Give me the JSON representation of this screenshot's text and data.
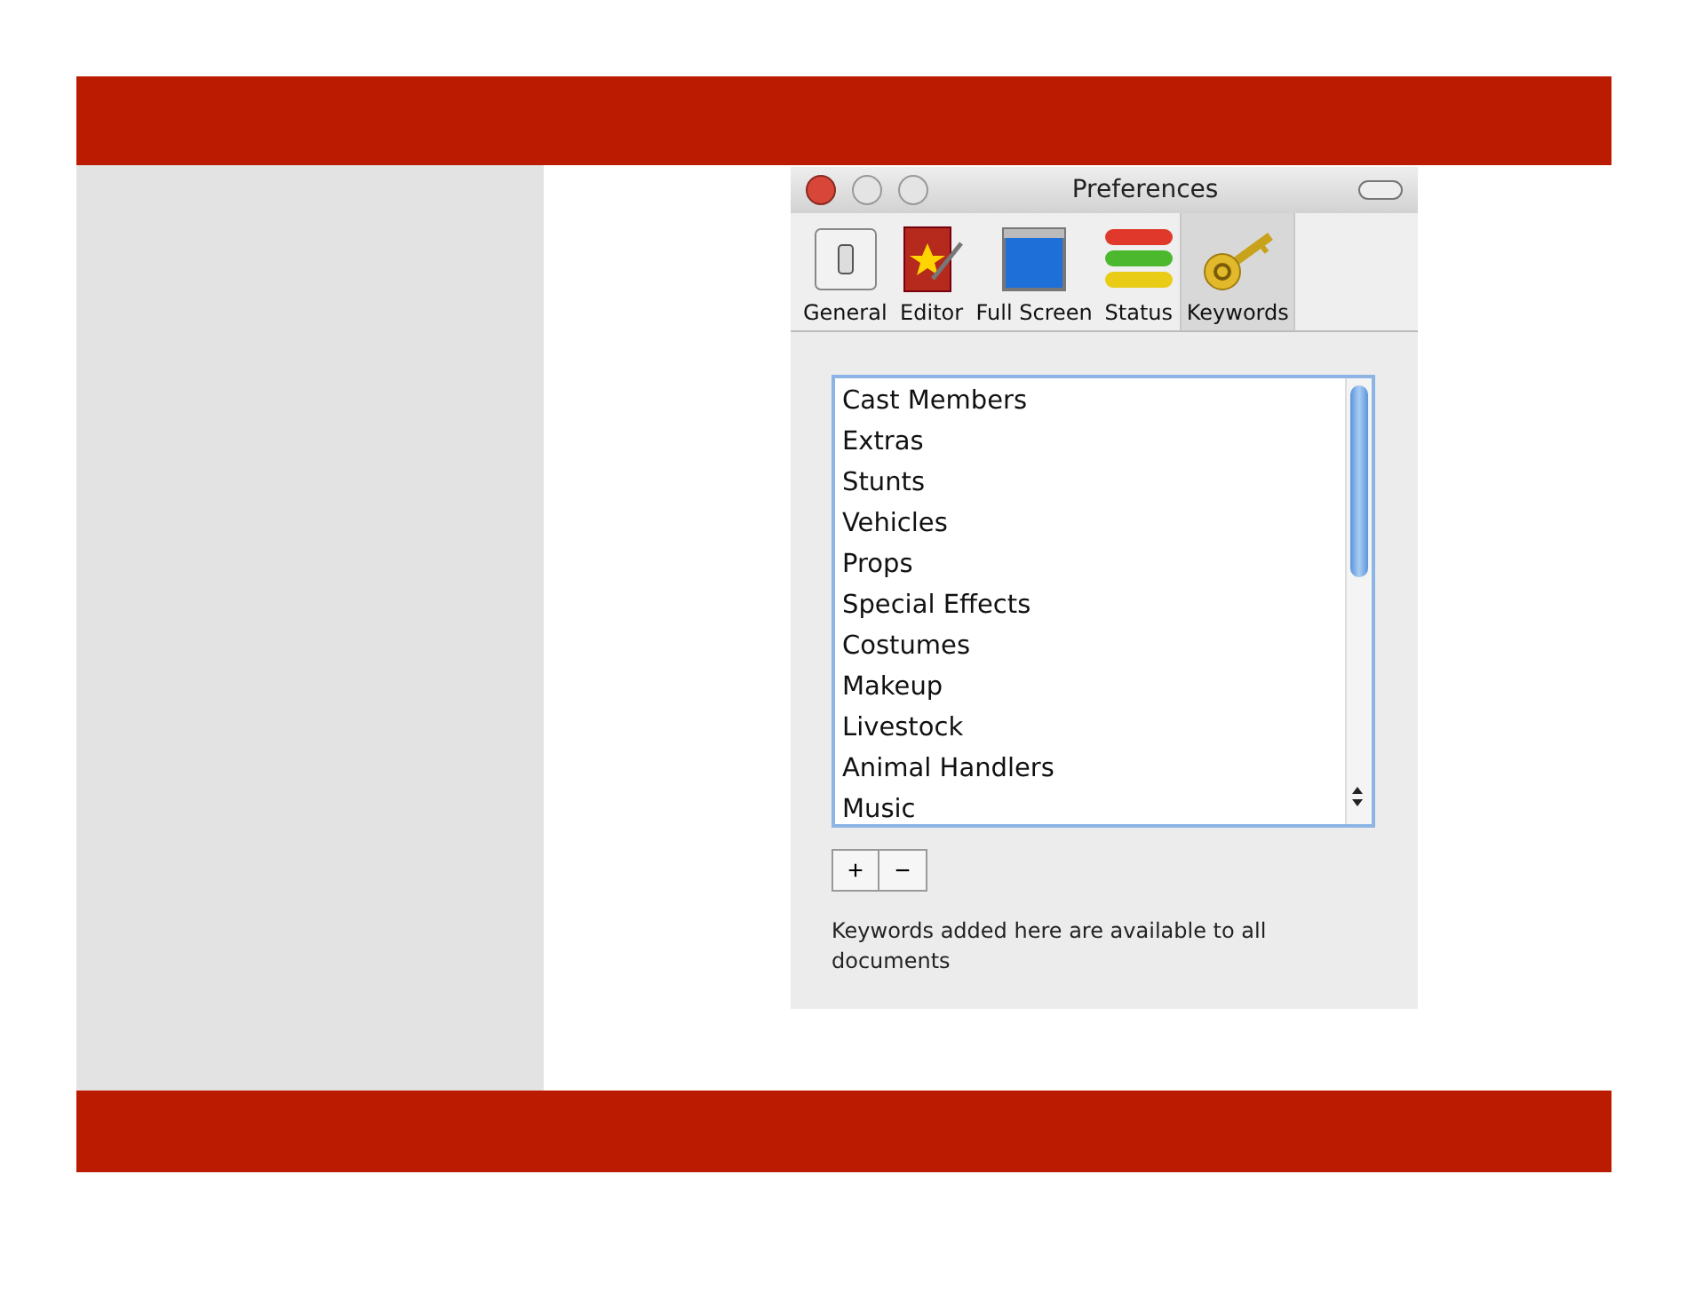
{
  "window": {
    "title": "Preferences"
  },
  "toolbar": [
    {
      "label": "General",
      "kind": "switch",
      "selected": false
    },
    {
      "label": "Editor",
      "kind": "editor",
      "selected": false
    },
    {
      "label": "Full Screen",
      "kind": "screen",
      "selected": false
    },
    {
      "label": "Status",
      "kind": "status",
      "selected": false
    },
    {
      "label": "Keywords",
      "kind": "key",
      "selected": true
    }
  ],
  "keywords": [
    "Cast Members",
    "Extras",
    "Stunts",
    "Vehicles",
    "Props",
    "Special Effects",
    "Costumes",
    "Makeup",
    "Livestock",
    "Animal Handlers",
    "Music"
  ],
  "buttons": [
    "+",
    "−"
  ],
  "note": "Keywords added here are available to all documents"
}
